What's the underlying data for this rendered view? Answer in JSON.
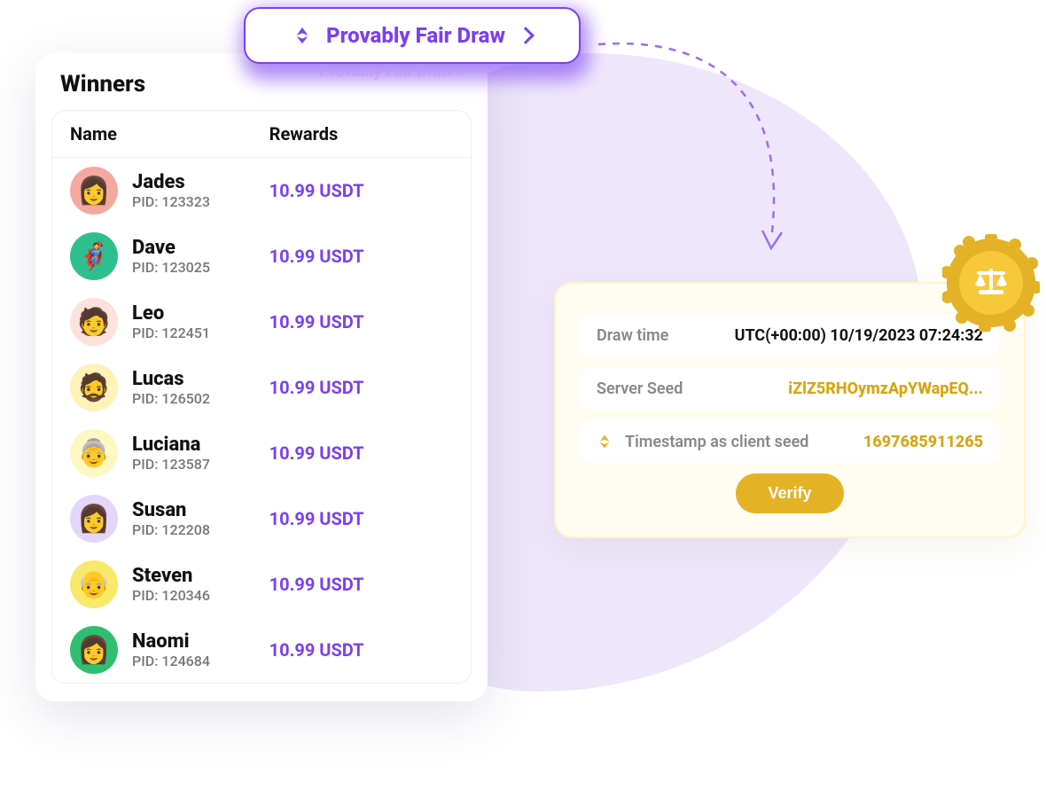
{
  "pill": {
    "label": "Provably Fair Draw",
    "ghost": "Provably Fair Draw  ›"
  },
  "winners": {
    "title": "Winners",
    "columns": {
      "name": "Name",
      "rewards": "Rewards"
    },
    "pid_prefix": "PID: ",
    "list": [
      {
        "name": "Jades",
        "pid": "123323",
        "reward": "10.99 USDT",
        "avatar_bg": "#F6A8A0",
        "emoji": "👩"
      },
      {
        "name": "Dave",
        "pid": "123025",
        "reward": "10.99 USDT",
        "avatar_bg": "#2FBF8F",
        "emoji": "🦸"
      },
      {
        "name": "Leo",
        "pid": "122451",
        "reward": "10.99 USDT",
        "avatar_bg": "#FDE1DA",
        "emoji": "🧑"
      },
      {
        "name": "Lucas",
        "pid": "126502",
        "reward": "10.99 USDT",
        "avatar_bg": "#FFF2B8",
        "emoji": "🧔"
      },
      {
        "name": "Luciana",
        "pid": "123587",
        "reward": "10.99 USDT",
        "avatar_bg": "#FFF7C2",
        "emoji": "👵"
      },
      {
        "name": "Susan",
        "pid": "122208",
        "reward": "10.99 USDT",
        "avatar_bg": "#E4D6FB",
        "emoji": "👩"
      },
      {
        "name": "Steven",
        "pid": "120346",
        "reward": "10.99 USDT",
        "avatar_bg": "#F8E96A",
        "emoji": "👴"
      },
      {
        "name": "Naomi",
        "pid": "124684",
        "reward": "10.99 USDT",
        "avatar_bg": "#2FBF71",
        "emoji": "👩"
      }
    ]
  },
  "verify": {
    "draw_time_label": "Draw time",
    "draw_time_value": "UTC(+00:00) 10/19/2023 07:24:32",
    "server_seed_label": "Server Seed",
    "server_seed_value": "iZlZ5RHOymzApYWapEQ...",
    "client_seed_label": "Timestamp as client seed",
    "client_seed_value": "1697685911265",
    "button": "Verify"
  }
}
